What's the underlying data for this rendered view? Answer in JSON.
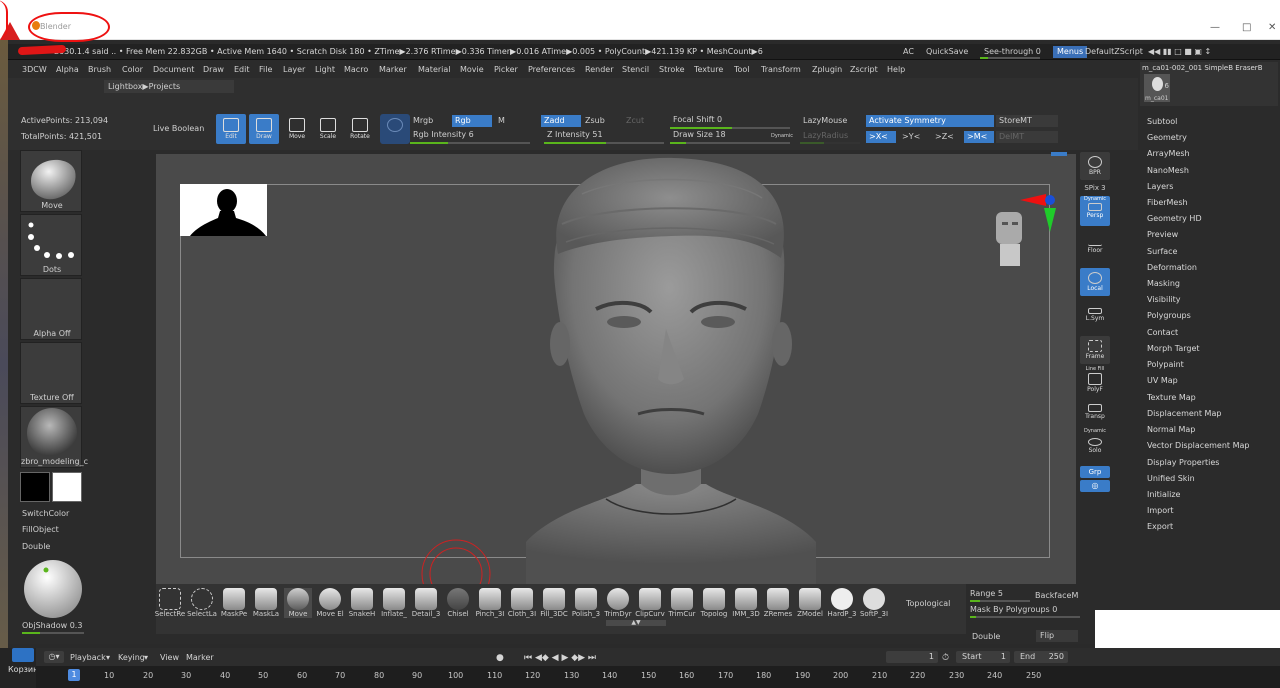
{
  "window": {
    "title": "Blender",
    "colors": {
      "accent": "#3a7cc8",
      "slider": "#5ab51c",
      "annotation": "#e11111"
    }
  },
  "zbrush": {
    "info_bar": "2030.1.4  said  .. • Free Mem 22.832GB • Active Mem 1640 • Scratch Disk 180 •  ZTime▶2.376 RTime▶0.336 Timer▶0.016 ATime▶0.005 • PolyCount▶421.139 KP  • MeshCount▶6",
    "ac": "AC",
    "quicksave": "QuickSave",
    "see_through": "See-through  0",
    "menus": "Menus",
    "default_script": "DefaultZScript",
    "menu": [
      "3DCW",
      "Alpha",
      "Brush",
      "Color",
      "Document",
      "Draw",
      "Edit",
      "File",
      "Layer",
      "Light",
      "Macro",
      "Marker",
      "Material",
      "Movie",
      "Picker",
      "Preferences",
      "Render",
      "Stencil",
      "Stroke",
      "Texture",
      "Tool",
      "Transform",
      "Zplugin",
      "Zscript",
      "Help"
    ],
    "lightbox": "Lightbox▶Projects",
    "active_points": "ActivePoints: 213,094",
    "total_points": "TotalPoints: 421,501",
    "live_boolean": "Live Boolean",
    "tools": [
      "Edit",
      "Draw",
      "Move",
      "Scale",
      "Rotate"
    ],
    "mrgb": "Mrgb",
    "rgb": "Rgb",
    "m": "M",
    "rgb_intensity": "Rgb Intensity 6",
    "zadd": "Zadd",
    "zsub": "Zsub",
    "zcut": "Zcut",
    "z_intensity": "Z Intensity 51",
    "focal_shift": "Focal Shift 0",
    "draw_size": "Draw Size 18",
    "dynamic": "Dynamic",
    "lazymouse": "LazyMouse",
    "lazyradius": "LazyRadius",
    "activate_symmetry": "Activate Symmetry",
    "sym_x": ">X<",
    "sym_y": ">Y<",
    "sym_z": ">Z<",
    "sym_m": ">M<",
    "storemt": "StoreMT",
    "delmt": "DelMT",
    "left_tray": {
      "move": "Move",
      "dots": "Dots",
      "alpha_off": "Alpha Off",
      "texture_off": "Texture Off",
      "material": "zbro_modeling_c",
      "switch_color": "SwitchColor",
      "fill_object": "FillObject",
      "double": "Double",
      "obj_shadow": "ObjShadow 0.3"
    },
    "right_tools": {
      "bpr": "BPR",
      "spix": "SPix 3",
      "dynamic": "Dynamic",
      "persp": "Persp",
      "floor": "Floor",
      "local": "Local",
      "lsym": "L.Sym",
      "frame": "Frame",
      "linefill": "Line Fill",
      "polyf": "PolyF",
      "transp": "Transp",
      "solo": "Solo",
      "grp": "Grp"
    },
    "subtool_header": "m_ca01-002_001  SimpleB EraserB",
    "subtool_count": "6",
    "subtool_thumb": "m_ca01",
    "palette": [
      "Subtool",
      "Geometry",
      "ArrayMesh",
      "NanoMesh",
      "Layers",
      "FiberMesh",
      "Geometry HD",
      "Preview",
      "Surface",
      "Deformation",
      "Masking",
      "Visibility",
      "Polygroups",
      "Contact",
      "Morph Target",
      "Polypaint",
      "UV Map",
      "Texture Map",
      "Displacement Map",
      "Normal Map",
      "Vector Displacement Map",
      "Display Properties",
      "Unified Skin",
      "Initialize",
      "Import",
      "Export"
    ],
    "brushes": [
      "SelectRe",
      "SelectLa",
      "MaskPe",
      "MaskLa",
      "Move",
      "Move El",
      "SnakeH",
      "Inflate_",
      "Detail_3",
      "Chisel",
      "Pinch_3I",
      "Cloth_3I",
      "Fill_3DC",
      "Polish_3",
      "TrimDyr",
      "ClipCurv",
      "TrimCur",
      "Topolog",
      "IMM_3D",
      "ZRemes",
      "ZModel",
      "HardP_3",
      "SoftP_3I"
    ],
    "selected_brush": "Move",
    "topological": "Topological",
    "range": "Range 5",
    "backface": "BackfaceM",
    "mask_by_polygroups": "Mask By Polygroups 0",
    "double2": "Double",
    "flip": "Flip"
  },
  "timeline": {
    "playback": "Playback",
    "keying": "Keying",
    "view": "View",
    "marker": "Marker",
    "current_frame": "1",
    "start_label": "Start",
    "start": "1",
    "end_label": "End",
    "end": "250",
    "ticks": [
      "10",
      "20",
      "30",
      "40",
      "50",
      "60",
      "70",
      "80",
      "90",
      "100",
      "110",
      "120",
      "130",
      "140",
      "150",
      "160",
      "170",
      "180",
      "190",
      "200",
      "210",
      "220",
      "230",
      "240",
      "250"
    ],
    "playhead": "1"
  },
  "desktop": {
    "label": "Корзин"
  }
}
